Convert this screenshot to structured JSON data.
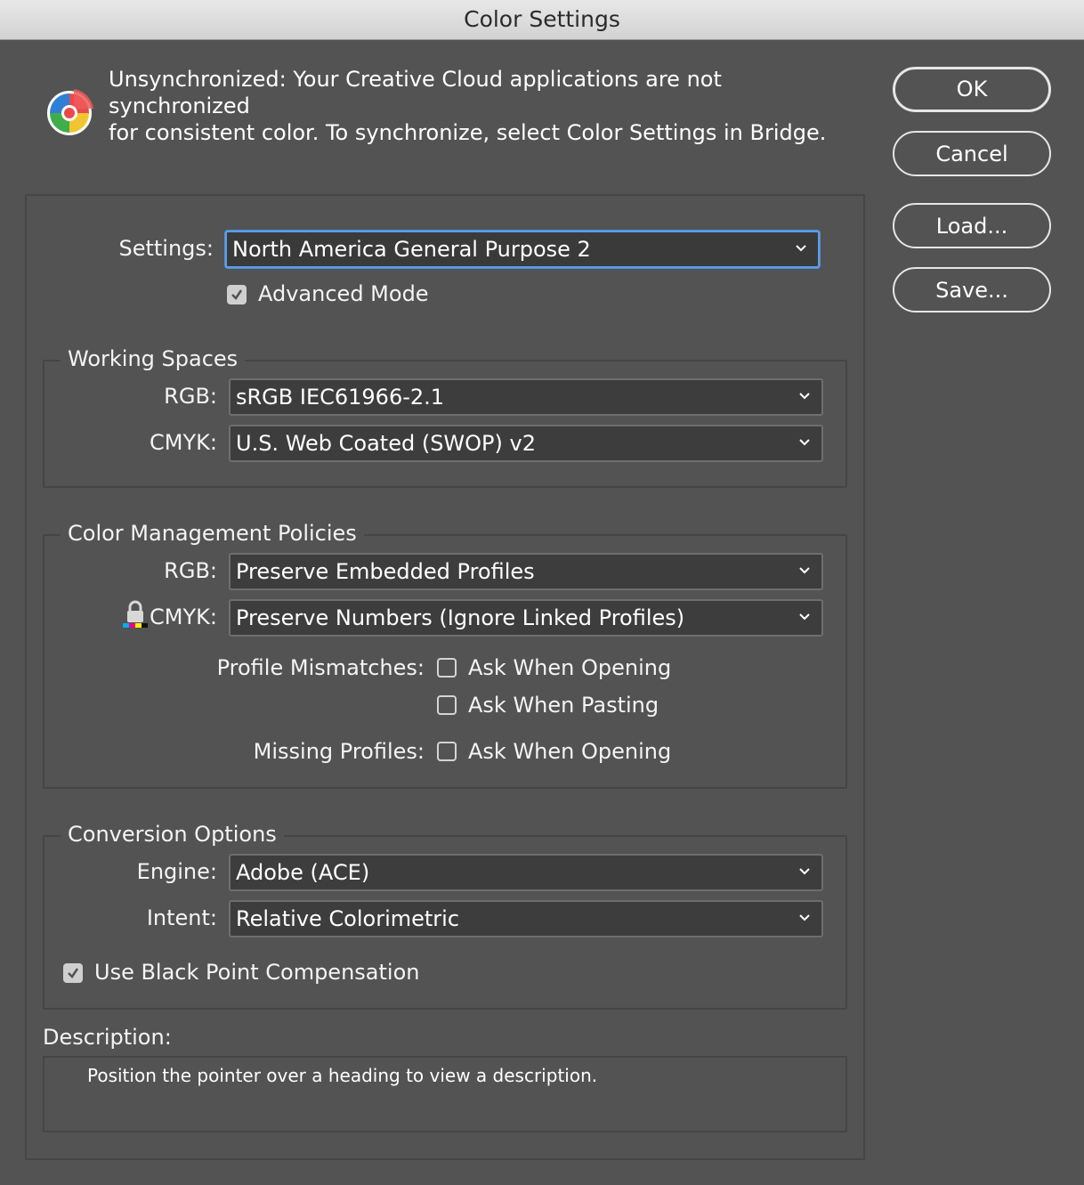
{
  "window": {
    "title": "Color Settings"
  },
  "sync": {
    "line1": "Unsynchronized: Your Creative Cloud applications are not synchronized",
    "line2": "for consistent color. To synchronize, select Color Settings in Bridge."
  },
  "buttons": {
    "ok": "OK",
    "cancel": "Cancel",
    "load": "Load...",
    "save": "Save..."
  },
  "settings": {
    "label": "Settings:",
    "value": "North America General Purpose 2"
  },
  "advanced_mode": {
    "label": "Advanced Mode",
    "checked": true
  },
  "working_spaces": {
    "title": "Working Spaces",
    "rgb_label": "RGB:",
    "rgb_value": "sRGB IEC61966-2.1",
    "cmyk_label": "CMYK:",
    "cmyk_value": "U.S. Web Coated (SWOP) v2"
  },
  "policies": {
    "title": "Color Management Policies",
    "rgb_label": "RGB:",
    "rgb_value": "Preserve Embedded Profiles",
    "cmyk_label": "CMYK:",
    "cmyk_value": "Preserve Numbers (Ignore Linked Profiles)",
    "mismatch_label": "Profile Mismatches:",
    "mismatch_open": "Ask When Opening",
    "mismatch_paste": "Ask When Pasting",
    "missing_label": "Missing Profiles:",
    "missing_open": "Ask When Opening"
  },
  "conversion": {
    "title": "Conversion Options",
    "engine_label": "Engine:",
    "engine_value": "Adobe (ACE)",
    "intent_label": "Intent:",
    "intent_value": "Relative Colorimetric",
    "bpc_label": "Use Black Point Compensation",
    "bpc_checked": true
  },
  "description": {
    "label": "Description:",
    "text": "Position the pointer over a heading to view a description."
  },
  "colors": {
    "accent": "#5d9de8",
    "background": "#535353",
    "field": "#3d3d3d"
  }
}
